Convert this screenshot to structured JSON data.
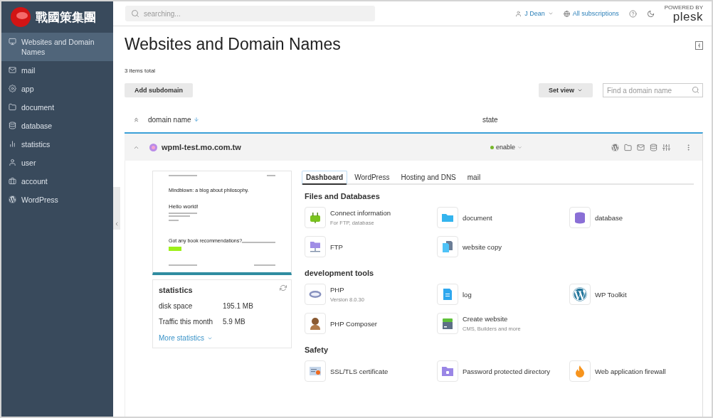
{
  "logo": {
    "text": "戰國策集團"
  },
  "sidebar": {
    "items": [
      {
        "label": "Websites and Domain Names",
        "selected": true
      },
      {
        "label": "mail",
        "selected": false
      },
      {
        "label": "app",
        "selected": false
      },
      {
        "label": "document",
        "selected": false
      },
      {
        "label": "database",
        "selected": false
      },
      {
        "label": "statistics",
        "selected": false
      },
      {
        "label": "user",
        "selected": false
      },
      {
        "label": "account",
        "selected": false
      },
      {
        "label": "WordPress",
        "selected": false
      }
    ]
  },
  "topbar": {
    "search": {
      "placeholder": "searching..."
    },
    "user": "J Dean",
    "subscriptions": "All subscriptions",
    "brand": {
      "tagline": "POWERED BY",
      "name": "plesk"
    }
  },
  "page": {
    "title": "Websites and Domain Names",
    "count": "3 items total",
    "add_button": "Add subdomain",
    "view_button": "Set view",
    "find": {
      "placeholder": "Find a domain name"
    }
  },
  "table": {
    "columns": [
      "domain name",
      "state"
    ],
    "row": {
      "domain": "wpml-test.mo.com.tw",
      "status": {
        "label": "enable",
        "on": true
      },
      "expanded": true,
      "preview": {
        "headline": "Mindblown: a blog about philosophy.",
        "post": "Hello world!",
        "question": "Got any book recommendations?"
      },
      "statistics": {
        "title": "statistics",
        "rows": [
          {
            "label": "disk space",
            "value": "195.1 MB"
          },
          {
            "label": "Traffic this month",
            "value": "5.9 MB"
          }
        ],
        "more": "More statistics"
      },
      "tabs": [
        {
          "label": "Dashboard",
          "selected": true
        },
        {
          "label": "WordPress",
          "selected": false
        },
        {
          "label": "Hosting and DNS",
          "selected": false
        },
        {
          "label": "mail",
          "selected": false
        }
      ],
      "sections": [
        {
          "title": "Files and Databases",
          "tools": [
            {
              "label": "Connect information",
              "note": "For FTP, database"
            },
            {
              "label": "document"
            },
            {
              "label": "database"
            },
            {
              "label": "FTP"
            },
            {
              "label": "website copy"
            }
          ]
        },
        {
          "title": "development tools",
          "tools": [
            {
              "label": "PHP",
              "note": "Version 8.0.30"
            },
            {
              "label": "log"
            },
            {
              "label": "WP Toolkit"
            },
            {
              "label": "PHP Composer"
            },
            {
              "label": "Create website",
              "note": "CMS, Builders and more"
            }
          ]
        },
        {
          "title": "Safety",
          "tools": [
            {
              "label": "SSL/TLS certificate"
            },
            {
              "label": "Password protected directory"
            },
            {
              "label": "Web application firewall"
            }
          ]
        }
      ]
    }
  }
}
